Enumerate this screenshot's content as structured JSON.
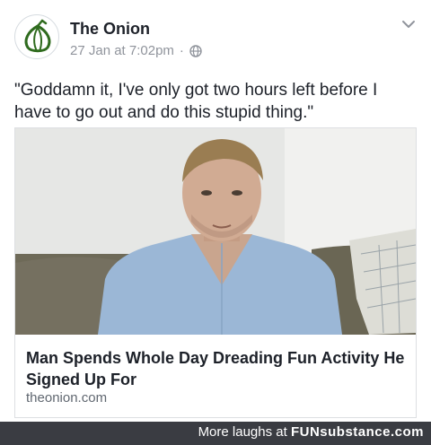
{
  "post": {
    "page_name": "The Onion",
    "timestamp": "27 Jan at 7:02pm",
    "separator": "·",
    "caption": "\"Goddamn it, I've only got two hours left before I have to go out and do this stupid thing.\"",
    "link": {
      "headline": "Man Spends Whole Day Dreading Fun Activity He Signed Up For",
      "domain": "theonion.com"
    },
    "icons": {
      "avatar": "onion-logo-icon",
      "privacy": "globe-icon",
      "menu": "chevron-down-icon"
    }
  },
  "watermark": {
    "prefix": "More laughs at ",
    "brand": "FUNsubstance.com"
  },
  "colors": {
    "onion_green": "#2f6b1e",
    "meta_gray": "#90949c",
    "footer_bg": "#3a3c42"
  }
}
